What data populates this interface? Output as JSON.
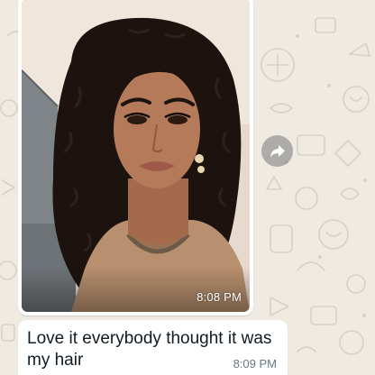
{
  "messages": [
    {
      "type": "image",
      "time": "8:08 PM",
      "image_description_icon": "selfie-photo"
    },
    {
      "type": "text",
      "text": "Love it everybody thought it was my hair",
      "time": "8:09 PM"
    }
  ],
  "forward_icon": "forward-arrow-icon",
  "colors": {
    "wallpaper": "#efeae2",
    "bubble": "#ffffff",
    "text": "#111b21",
    "meta": "#667781",
    "forward_bg": "#8a8a8a"
  }
}
